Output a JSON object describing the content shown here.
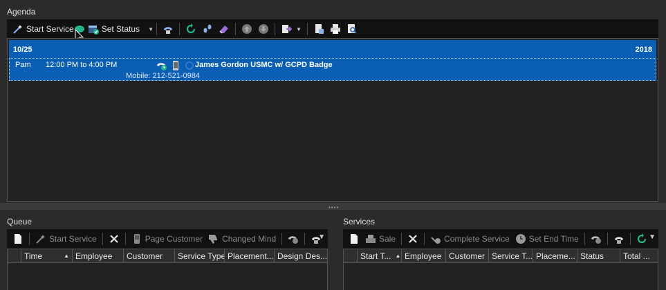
{
  "agenda": {
    "label": "Agenda",
    "toolbar": {
      "start_service": "Start Service",
      "set_status": "Set Status"
    },
    "date": "10/25",
    "year": "2018",
    "appointment": {
      "employee": "Pam",
      "time": "12:00 PM to 4:00 PM",
      "customer": "James Gordon USMC w/ GCPD Badge",
      "mobile": "Mobile: 212-521-0984"
    }
  },
  "queue": {
    "label": "Queue",
    "toolbar": {
      "start_service": "Start Service",
      "page_customer": "Page Customer",
      "changed_mind": "Changed Mind"
    },
    "columns": [
      "Time",
      "Employee",
      "Customer",
      "Service Type",
      "Placement...",
      "Design Des..."
    ]
  },
  "services": {
    "label": "Services",
    "toolbar": {
      "sale": "Sale",
      "complete_service": "Complete Service",
      "set_end_time": "Set End Time"
    },
    "columns": [
      "Start T...",
      "Employee",
      "Customer",
      "Service T...",
      "Placeme...",
      "Status",
      "Total ..."
    ]
  },
  "colors": {
    "selection_blue": "#0a5fb4",
    "teal_accent": "#1fb58f"
  }
}
